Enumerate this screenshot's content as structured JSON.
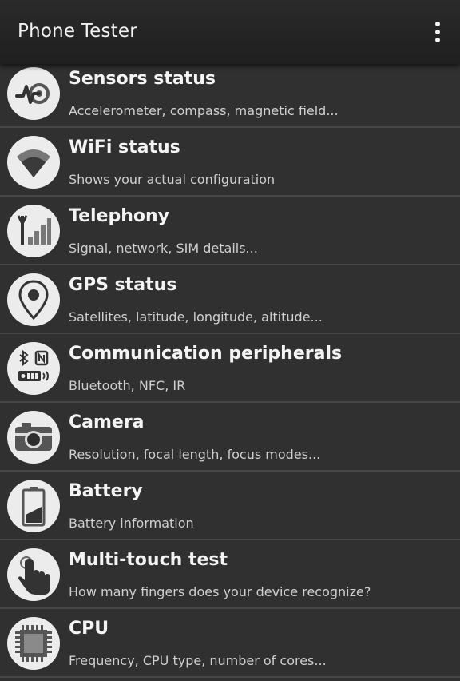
{
  "appbar": {
    "title": "Phone Tester",
    "menu_icon": "overflow-menu-icon"
  },
  "items": [
    {
      "title": "Sensors status",
      "subtitle": "Accelerometer, compass, magnetic field...",
      "icon": "sensor-pulse-icon"
    },
    {
      "title": "WiFi status",
      "subtitle": "Shows your actual configuration",
      "icon": "wifi-icon"
    },
    {
      "title": "Telephony",
      "subtitle": "Signal, network, SIM details...",
      "icon": "signal-antenna-icon"
    },
    {
      "title": "GPS status",
      "subtitle": "Satellites, latitude, longitude, altitude...",
      "icon": "location-pin-icon"
    },
    {
      "title": "Communication peripherals",
      "subtitle": "Bluetooth, NFC, IR",
      "icon": "bluetooth-nfc-ir-icon"
    },
    {
      "title": "Camera",
      "subtitle": "Resolution, focal length, focus modes...",
      "icon": "camera-icon"
    },
    {
      "title": "Battery",
      "subtitle": "Battery information",
      "icon": "battery-icon"
    },
    {
      "title": "Multi-touch test",
      "subtitle": "How many fingers does your device recognize?",
      "icon": "touch-hand-icon"
    },
    {
      "title": "CPU",
      "subtitle": "Frequency, CPU type, number of cores...",
      "icon": "cpu-chip-icon"
    }
  ]
}
